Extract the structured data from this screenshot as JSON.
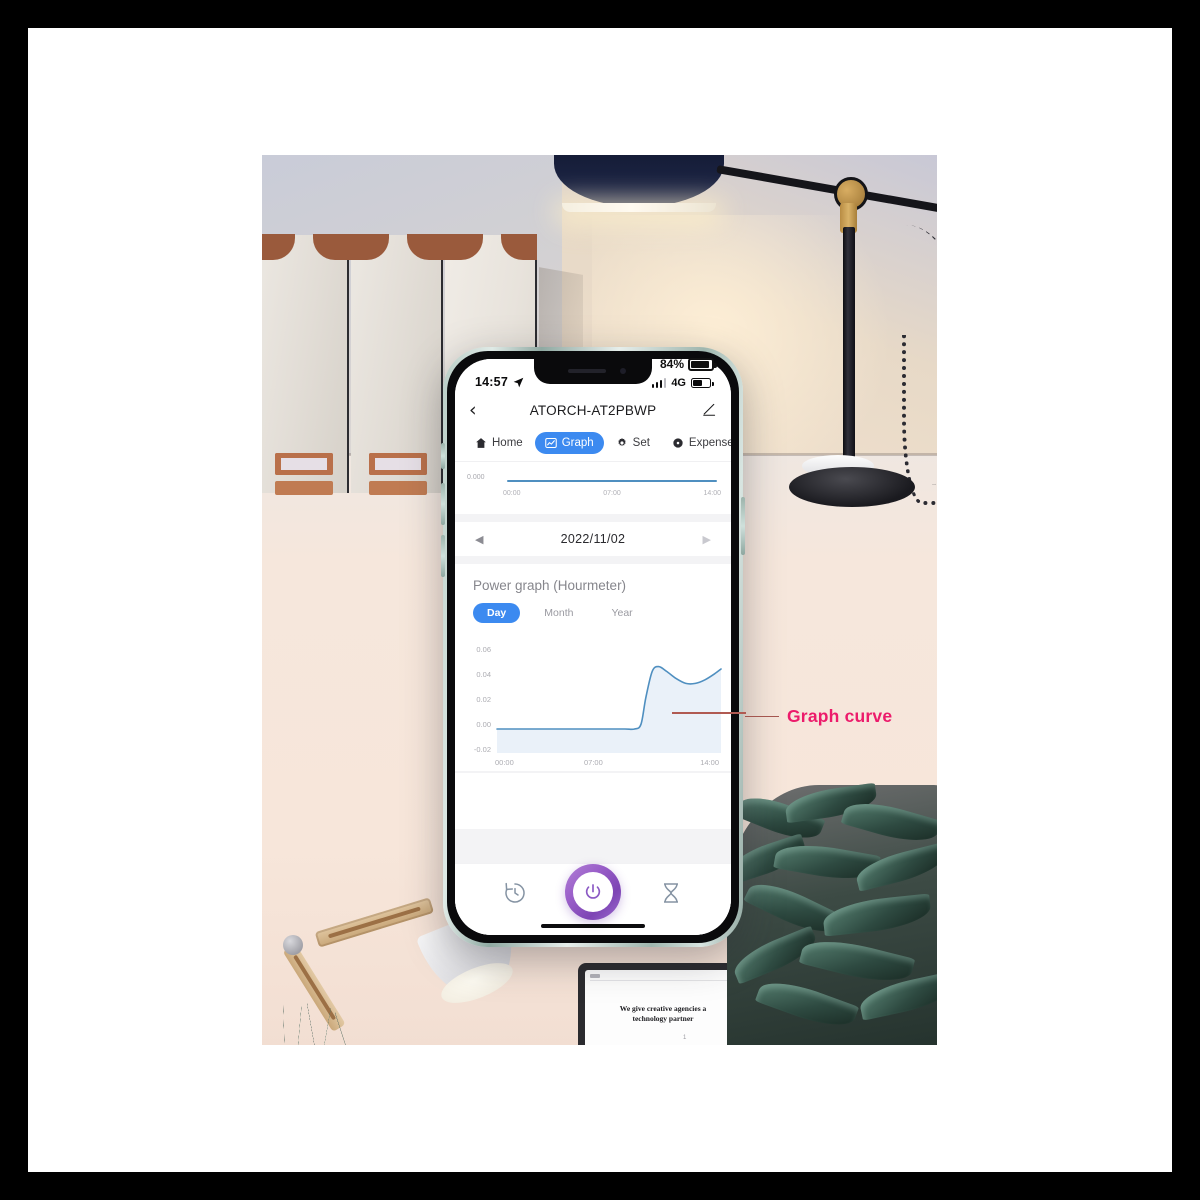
{
  "scene": {
    "description": "desk-photo-background",
    "tablet_text": "We give creative agencies a technology partner",
    "tablet_page": "1",
    "external_battery_percent": "84%"
  },
  "phone": {
    "statusbar": {
      "time": "14:57",
      "location_icon": "location-arrow-icon",
      "signal_icon": "signal-bars-icon",
      "network": "4G",
      "battery_icon": "battery-icon"
    },
    "navbar": {
      "back_icon": "chevron-left-icon",
      "title": "ATORCH-AT2PBWP",
      "edit_icon": "pencil-edit-icon"
    },
    "tabs": [
      {
        "label": "Home",
        "icon": "home-icon",
        "active": false
      },
      {
        "label": "Graph",
        "icon": "line-chart-icon",
        "active": true
      },
      {
        "label": "Set",
        "icon": "gear-icon",
        "active": false
      },
      {
        "label": "Expense",
        "icon": "coin-icon",
        "active": false
      }
    ],
    "mini_chart": {
      "y_label": "0.000",
      "x_labels": [
        "00:00",
        "07:00",
        "14:00"
      ]
    },
    "date_nav": {
      "prev_icon": "triangle-left-icon",
      "date": "2022/11/02",
      "next_icon": "triangle-right-icon"
    },
    "power_section": {
      "title": "Power graph (Hourmeter)",
      "range_tabs": [
        {
          "label": "Day",
          "active": true
        },
        {
          "label": "Month",
          "active": false
        },
        {
          "label": "Year",
          "active": false
        }
      ]
    },
    "bottombar": {
      "left_icon": "history-clock-icon",
      "power_icon": "power-button-icon",
      "right_icon": "hourglass-icon"
    }
  },
  "annotation": {
    "label": "Graph curve",
    "color": "#ec1b6b",
    "line_color": "#a4564f"
  },
  "colors": {
    "accent_blue": "#3c8af0",
    "chart_line": "#4f8fc0",
    "chart_fill": "#eaf1f9",
    "power_purple": "#8b59c4",
    "phone_frame": "#a9c0b8"
  },
  "chart_data": {
    "type": "area",
    "title": "Power graph (Hourmeter)",
    "xlabel": "",
    "ylabel": "",
    "ylim": [
      -0.02,
      0.07
    ],
    "xlim": [
      0,
      14
    ],
    "yticks": [
      "0.06",
      "0.04",
      "0.02",
      "0.00",
      "-0.02"
    ],
    "ytick_values": [
      0.06,
      0.04,
      0.02,
      0.0,
      -0.02
    ],
    "xticks": [
      "00:00",
      "07:00",
      "14:00"
    ],
    "xtick_values": [
      0,
      7,
      14
    ],
    "grid": false,
    "legend": "none",
    "series": [
      {
        "name": "Power (Hourmeter)",
        "color": "#4f8fc0",
        "fill": "#eaf1f9",
        "x": [
          0.0,
          1.0,
          2.0,
          3.0,
          4.0,
          5.0,
          6.0,
          7.0,
          8.0,
          8.6,
          9.0,
          9.3,
          9.7,
          10.1,
          10.6,
          11.2,
          11.8,
          12.4,
          13.0,
          13.6,
          14.0
        ],
        "values": [
          0.0,
          0.0,
          0.0,
          0.0,
          0.0,
          0.0,
          0.0,
          0.0,
          0.0,
          0.0,
          0.004,
          0.026,
          0.048,
          0.052,
          0.048,
          0.042,
          0.038,
          0.038,
          0.041,
          0.046,
          0.05
        ]
      }
    ]
  },
  "chart_data_mini": {
    "type": "line",
    "title": "",
    "yticks": [
      "0.000"
    ],
    "xticks": [
      "00:00",
      "07:00",
      "14:00"
    ],
    "xtick_values": [
      0,
      7,
      14
    ],
    "series": [
      {
        "name": "flat",
        "color": "#4f8fc0",
        "x": [
          0,
          7,
          14
        ],
        "values": [
          0.0,
          0.0,
          0.0
        ]
      }
    ]
  }
}
